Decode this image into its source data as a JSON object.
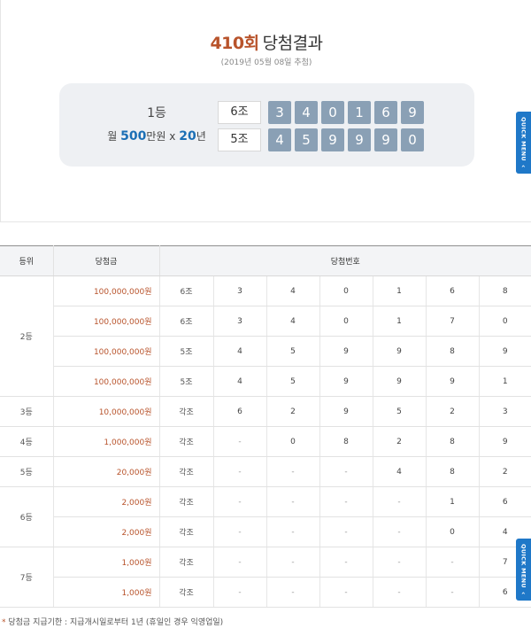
{
  "header": {
    "round": "410회",
    "label": "당첨결과",
    "draw_date": "(2019년 05월 08일 추첨)"
  },
  "first_prize": {
    "rank": "1등",
    "monthly_prefix": "월",
    "monthly_amount": "500",
    "monthly_unit": "만원 x",
    "years": "20",
    "years_unit": "년",
    "rows": [
      {
        "group": "6조",
        "digits": [
          "3",
          "4",
          "0",
          "1",
          "6",
          "9"
        ]
      },
      {
        "group": "5조",
        "digits": [
          "4",
          "5",
          "9",
          "9",
          "9",
          "0"
        ]
      }
    ]
  },
  "quick_menu": {
    "label": "QUICK MENU",
    "chevron": "‹"
  },
  "table": {
    "headers": {
      "rank": "등위",
      "prize": "당첨금",
      "numbers": "당첨번호"
    },
    "rank_labels": [
      "2등",
      "3등",
      "4등",
      "5등",
      "6등",
      "7등"
    ],
    "rows": [
      {
        "prize": "100,000,000원",
        "group": "6조",
        "digits": [
          "3",
          "4",
          "0",
          "1",
          "6",
          "8"
        ]
      },
      {
        "prize": "100,000,000원",
        "group": "6조",
        "digits": [
          "3",
          "4",
          "0",
          "1",
          "7",
          "0"
        ]
      },
      {
        "prize": "100,000,000원",
        "group": "5조",
        "digits": [
          "4",
          "5",
          "9",
          "9",
          "8",
          "9"
        ]
      },
      {
        "prize": "100,000,000원",
        "group": "5조",
        "digits": [
          "4",
          "5",
          "9",
          "9",
          "9",
          "1"
        ]
      },
      {
        "prize": "10,000,000원",
        "group": "각조",
        "digits": [
          "6",
          "2",
          "9",
          "5",
          "2",
          "3"
        ]
      },
      {
        "prize": "1,000,000원",
        "group": "각조",
        "digits": [
          "-",
          "0",
          "8",
          "2",
          "8",
          "9"
        ]
      },
      {
        "prize": "20,000원",
        "group": "각조",
        "digits": [
          "-",
          "-",
          "-",
          "4",
          "8",
          "2"
        ]
      },
      {
        "prize": "2,000원",
        "group": "각조",
        "digits": [
          "-",
          "-",
          "-",
          "-",
          "1",
          "6"
        ]
      },
      {
        "prize": "2,000원",
        "group": "각조",
        "digits": [
          "-",
          "-",
          "-",
          "-",
          "0",
          "4"
        ]
      },
      {
        "prize": "1,000원",
        "group": "각조",
        "digits": [
          "-",
          "-",
          "-",
          "-",
          "-",
          "7"
        ]
      },
      {
        "prize": "1,000원",
        "group": "각조",
        "digits": [
          "-",
          "-",
          "-",
          "-",
          "-",
          "6"
        ]
      }
    ]
  },
  "footnote": {
    "star": "*",
    "text": "당첨금 지급기한 : 지급개시일로부터 1년 (휴일인 경우 익영업일)"
  },
  "colors": {
    "accent": "#b8532b",
    "ball": "#8aa0b5",
    "quick_menu": "#1f78c8",
    "highlight_blue": "#1b6fb5"
  }
}
